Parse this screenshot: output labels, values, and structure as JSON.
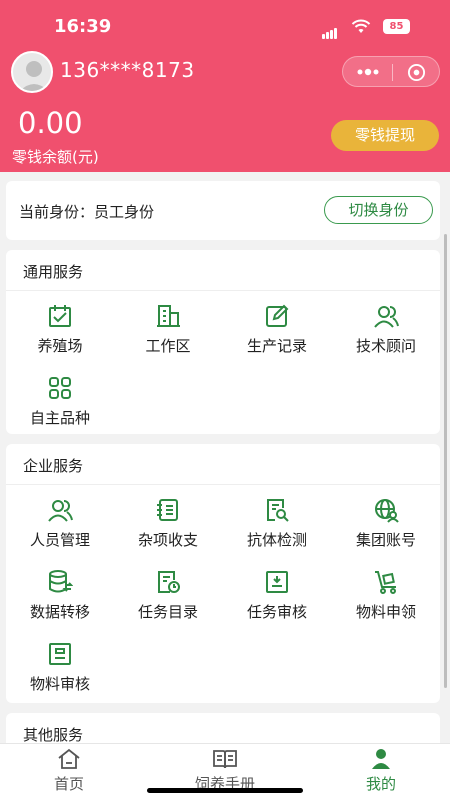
{
  "status_bar": {
    "time": "16:39",
    "battery": "85"
  },
  "user": {
    "phone": "136****8173"
  },
  "wallet": {
    "balance": "0.00",
    "balance_label": "零钱余额(元)",
    "withdraw_label": "零钱提现"
  },
  "identity": {
    "label": "当前身份：员工身份",
    "switch_label": "切换身份"
  },
  "general_services": {
    "title": "通用服务",
    "items": [
      {
        "label": "养殖场",
        "icon": "calendar-check-icon"
      },
      {
        "label": "工作区",
        "icon": "building-icon"
      },
      {
        "label": "生产记录",
        "icon": "edit-note-icon"
      },
      {
        "label": "技术顾问",
        "icon": "user-group-icon"
      },
      {
        "label": "自主品种",
        "icon": "grid-icon"
      }
    ]
  },
  "enterprise_services": {
    "title": "企业服务",
    "items": [
      {
        "label": "人员管理",
        "icon": "people-icon"
      },
      {
        "label": "杂项收支",
        "icon": "ledger-icon"
      },
      {
        "label": "抗体检测",
        "icon": "document-search-icon"
      },
      {
        "label": "集团账号",
        "icon": "globe-user-icon"
      },
      {
        "label": "数据转移",
        "icon": "database-transfer-icon"
      },
      {
        "label": "任务目录",
        "icon": "task-clock-icon"
      },
      {
        "label": "任务审核",
        "icon": "review-tray-icon"
      },
      {
        "label": "物料申领",
        "icon": "cart-box-icon"
      },
      {
        "label": "物料审核",
        "icon": "material-review-icon"
      }
    ]
  },
  "other_services": {
    "title": "其他服务"
  },
  "tabbar": {
    "tabs": [
      {
        "label": "首页",
        "icon": "home-icon"
      },
      {
        "label": "饲养手册",
        "icon": "book-icon"
      },
      {
        "label": "我的",
        "icon": "user-icon"
      }
    ]
  },
  "colors": {
    "brand_pink": "#f0506e",
    "accent_green": "#2e8a43",
    "gold": "#e9b43a"
  }
}
